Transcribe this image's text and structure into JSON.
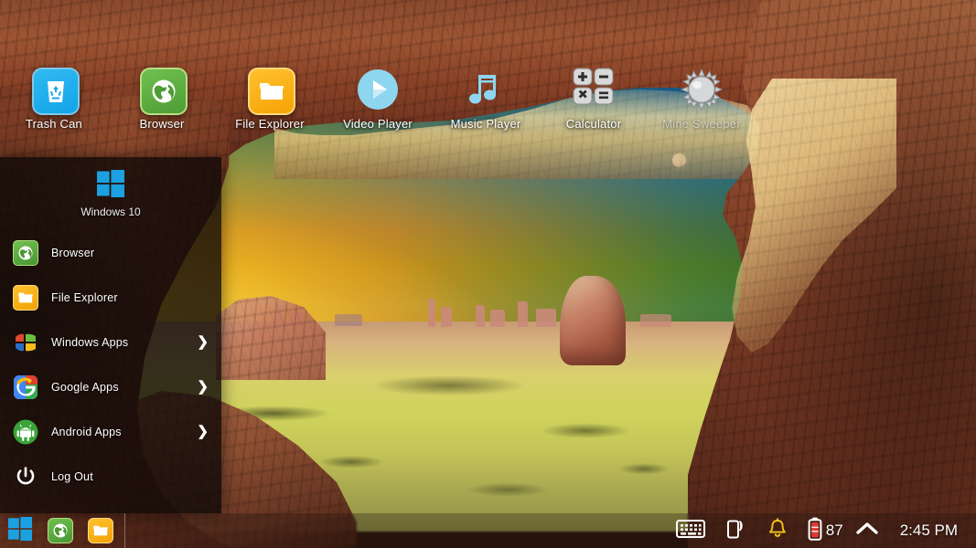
{
  "desktop": {
    "wallpaper_description": "Desert sandstone arch at sunset, Arches National Park",
    "colors": {
      "sky_top": "#1f6fa5",
      "sky_sun": "#f9e055",
      "rock_red": "#8b4a2e",
      "sandstone": "#f0d9a0",
      "taskbar": "rgba(30,16,12,0.30)",
      "start_menu": "rgba(12,8,6,0.80)"
    },
    "icons": [
      {
        "label": "Trash Can",
        "icon": "trash-can-icon",
        "faded": false
      },
      {
        "label": "Browser",
        "icon": "browser-globe-icon",
        "faded": false
      },
      {
        "label": "File Explorer",
        "icon": "folder-icon",
        "faded": false
      },
      {
        "label": "Video Player",
        "icon": "play-circle-icon",
        "faded": false
      },
      {
        "label": "Music Player",
        "icon": "music-note-icon",
        "faded": false
      },
      {
        "label": "Calculator",
        "icon": "calculator-icon",
        "faded": false
      },
      {
        "label": "Mine Sweeper",
        "icon": "mine-icon",
        "faded": true
      }
    ],
    "moon": {
      "visible": true
    }
  },
  "start_menu": {
    "header": {
      "title": "Windows 10",
      "logo": "windows-logo-icon"
    },
    "items": [
      {
        "label": "Browser",
        "icon": "browser-globe-icon",
        "has_submenu": false,
        "chevron": ""
      },
      {
        "label": "File Explorer",
        "icon": "folder-icon",
        "has_submenu": false,
        "chevron": ""
      },
      {
        "label": "Windows Apps",
        "icon": "windows-classic-icon",
        "has_submenu": true,
        "chevron": "❯"
      },
      {
        "label": "Google Apps",
        "icon": "google-g-icon",
        "has_submenu": true,
        "chevron": "❯"
      },
      {
        "label": "Android Apps",
        "icon": "android-robot-icon",
        "has_submenu": true,
        "chevron": "❯"
      },
      {
        "label": "Log Out",
        "icon": "power-icon",
        "has_submenu": false,
        "chevron": ""
      }
    ]
  },
  "taskbar": {
    "start_button": {
      "name": "start-button",
      "icon": "windows-logo-icon"
    },
    "pinned": [
      {
        "label": "Browser",
        "icon": "browser-globe-icon"
      },
      {
        "label": "File Explorer",
        "icon": "folder-icon"
      }
    ],
    "tray": [
      {
        "name": "keyboard-icon",
        "label": "Keyboard"
      },
      {
        "name": "mobile-signal-icon",
        "label": "Mobile data"
      },
      {
        "name": "bell-icon",
        "label": "Notifications",
        "color": "#f5c518"
      },
      {
        "name": "battery-icon",
        "label": "Battery",
        "color": "#e03a34"
      }
    ],
    "battery_percent": "87",
    "show_hidden_icons": "^",
    "clock": "2:45 PM"
  }
}
